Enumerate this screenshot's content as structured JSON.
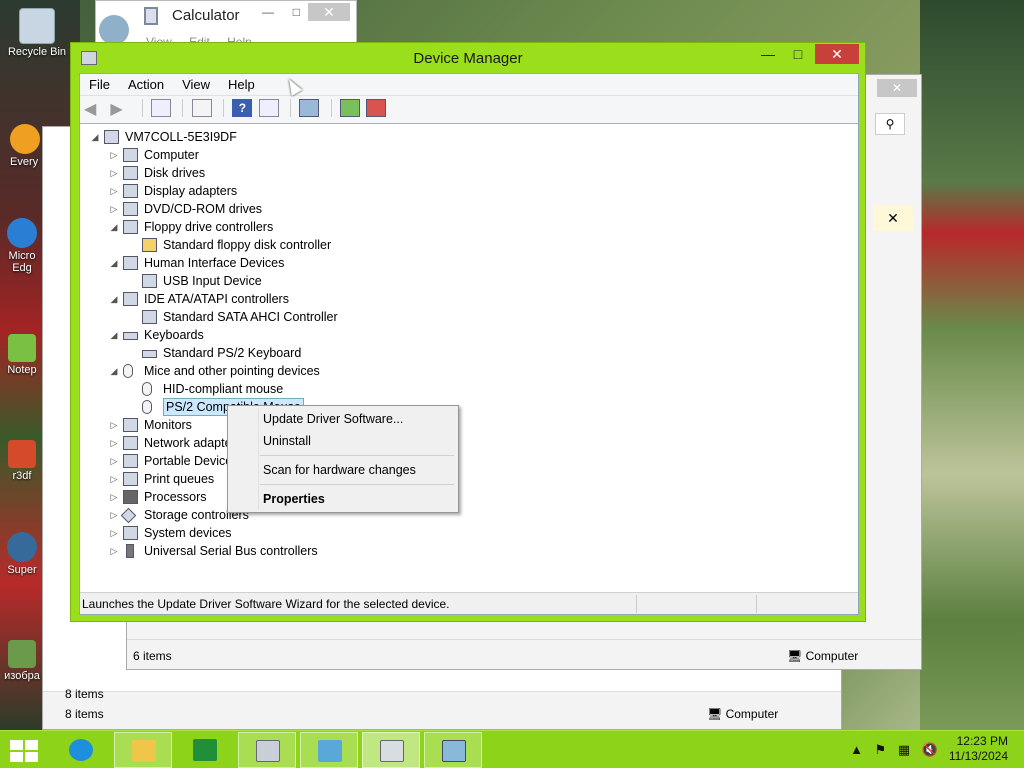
{
  "desktop": {
    "icons": [
      {
        "label": "Recycle Bin"
      },
      {
        "label": "Every"
      },
      {
        "label": "Micro Edg"
      },
      {
        "label": "Notep"
      },
      {
        "label": "r3df"
      },
      {
        "label": "Super"
      },
      {
        "label": "изобра"
      }
    ]
  },
  "calculator": {
    "title": "Calculator",
    "menu": "View Edit Help"
  },
  "explorer_back": {
    "status_items_a": "8 items",
    "status_items_b": "8 items",
    "status_location": "Computer"
  },
  "explorer_mid": {
    "status_items": "6 items",
    "status_location": "Computer"
  },
  "device_manager": {
    "title": "Device Manager",
    "menu": [
      "File",
      "Action",
      "View",
      "Help"
    ],
    "tree": {
      "root": "VM7COLL-5E3I9DF",
      "nodes": [
        {
          "label": "Computer"
        },
        {
          "label": "Disk drives"
        },
        {
          "label": "Display adapters"
        },
        {
          "label": "DVD/CD-ROM drives"
        },
        {
          "label": "Floppy drive controllers"
        },
        {
          "label": "Standard floppy disk controller"
        },
        {
          "label": "Human Interface Devices"
        },
        {
          "label": "USB Input Device"
        },
        {
          "label": "IDE ATA/ATAPI controllers"
        },
        {
          "label": "Standard SATA AHCI Controller"
        },
        {
          "label": "Keyboards"
        },
        {
          "label": "Standard PS/2 Keyboard"
        },
        {
          "label": "Mice and other pointing devices"
        },
        {
          "label": "HID-compliant mouse"
        },
        {
          "label": "PS/2 Compatible Mouse"
        },
        {
          "label": "Monitors"
        },
        {
          "label": "Network adapte"
        },
        {
          "label": "Portable Devices"
        },
        {
          "label": "Print queues"
        },
        {
          "label": "Processors"
        },
        {
          "label": "Storage controllers"
        },
        {
          "label": "System devices"
        },
        {
          "label": "Universal Serial Bus controllers"
        }
      ]
    },
    "status_text": "Launches the Update Driver Software Wizard for the selected device."
  },
  "context_menu": {
    "items": [
      "Update Driver Software...",
      "Uninstall",
      "Scan for hardware changes",
      "Properties"
    ]
  },
  "taskbar": {
    "time": "12:23 PM",
    "date": "11/13/2024"
  },
  "colors": {
    "window_accent": "#9ade1c",
    "taskbar": "#8dd31a",
    "close_red": "#c7403a",
    "selection": "#cce8ff"
  }
}
